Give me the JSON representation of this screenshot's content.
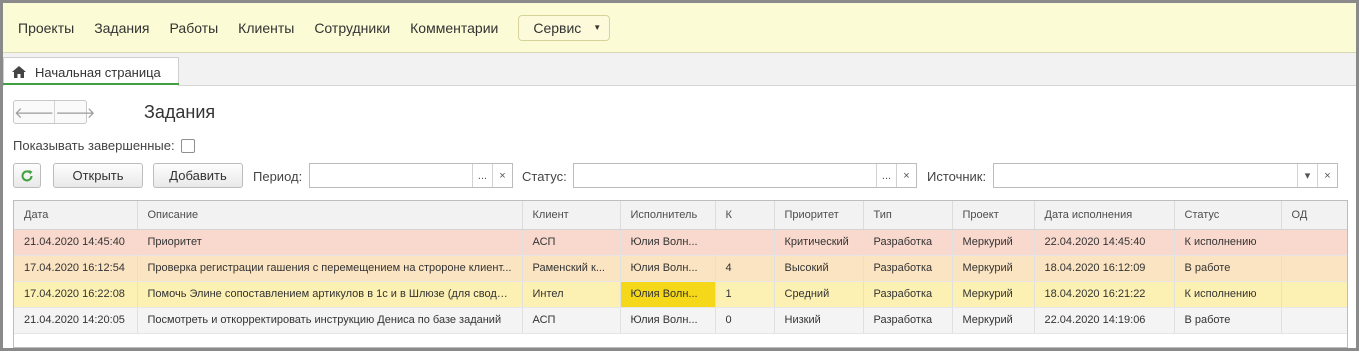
{
  "topnav": {
    "items": [
      "Проекты",
      "Задания",
      "Работы",
      "Клиенты",
      "Сотрудники",
      "Комментарии"
    ],
    "service_label": "Сервис"
  },
  "tab": {
    "label": "Начальная страница"
  },
  "page": {
    "title": "Задания",
    "show_completed_label": "Показывать завершенные:"
  },
  "toolbar": {
    "open_label": "Открыть",
    "add_label": "Добавить",
    "period_label": "Период:",
    "status_label": "Статус:",
    "source_label": "Источник:",
    "select_btn": "...",
    "clear_btn": "×",
    "dropdown_btn": "▾"
  },
  "table": {
    "columns": [
      "Дата",
      "Описание",
      "Клиент",
      "Исполнитель",
      "К",
      "Приоритет",
      "Тип",
      "Проект",
      "Дата исполнения",
      "Статус",
      "ОД"
    ],
    "rows": [
      {
        "bg": "#f9d9cd",
        "cells": [
          "21.04.2020 14:45:40",
          "Приоритет",
          "АСП",
          "Юлия Волн...",
          "",
          "Критический",
          "Разработка",
          "Меркурий",
          "22.04.2020 14:45:40",
          "К исполнению",
          ""
        ]
      },
      {
        "bg": "#fbe4c2",
        "cells": [
          "17.04.2020 16:12:54",
          "Проверка регистрации гашения с перемещением на стророне клиент...",
          "Раменский к...",
          "Юлия Волн...",
          "4",
          "Высокий",
          "Разработка",
          "Меркурий",
          "18.04.2020 16:12:09",
          "В работе",
          ""
        ]
      },
      {
        "bg": "#fcf0b3",
        "highlight_col": 3,
        "highlight_color": "#f5d81a",
        "cells": [
          "17.04.2020 16:22:08",
          "Помочь Элине сопоставлением артикулов в 1с и в Шлюзе (для сводн...",
          "Интел",
          "Юлия Волн...",
          "1",
          "Средний",
          "Разработка",
          "Меркурий",
          "18.04.2020 16:21:22",
          "К исполнению",
          ""
        ]
      },
      {
        "bg": "#f4f4f4",
        "cells": [
          "21.04.2020 14:20:05",
          "Посмотреть и откорректировать инструкцию Дениса по базе заданий",
          "АСП",
          "Юлия Волн...",
          "0",
          "Низкий",
          "Разработка",
          "Меркурий",
          "22.04.2020 14:19:06",
          "В работе",
          ""
        ]
      }
    ]
  },
  "colors": {
    "topnav_bg": "#fbfbd6",
    "refresh_icon": "#3fa142",
    "tab_accent": "#3fa142"
  }
}
